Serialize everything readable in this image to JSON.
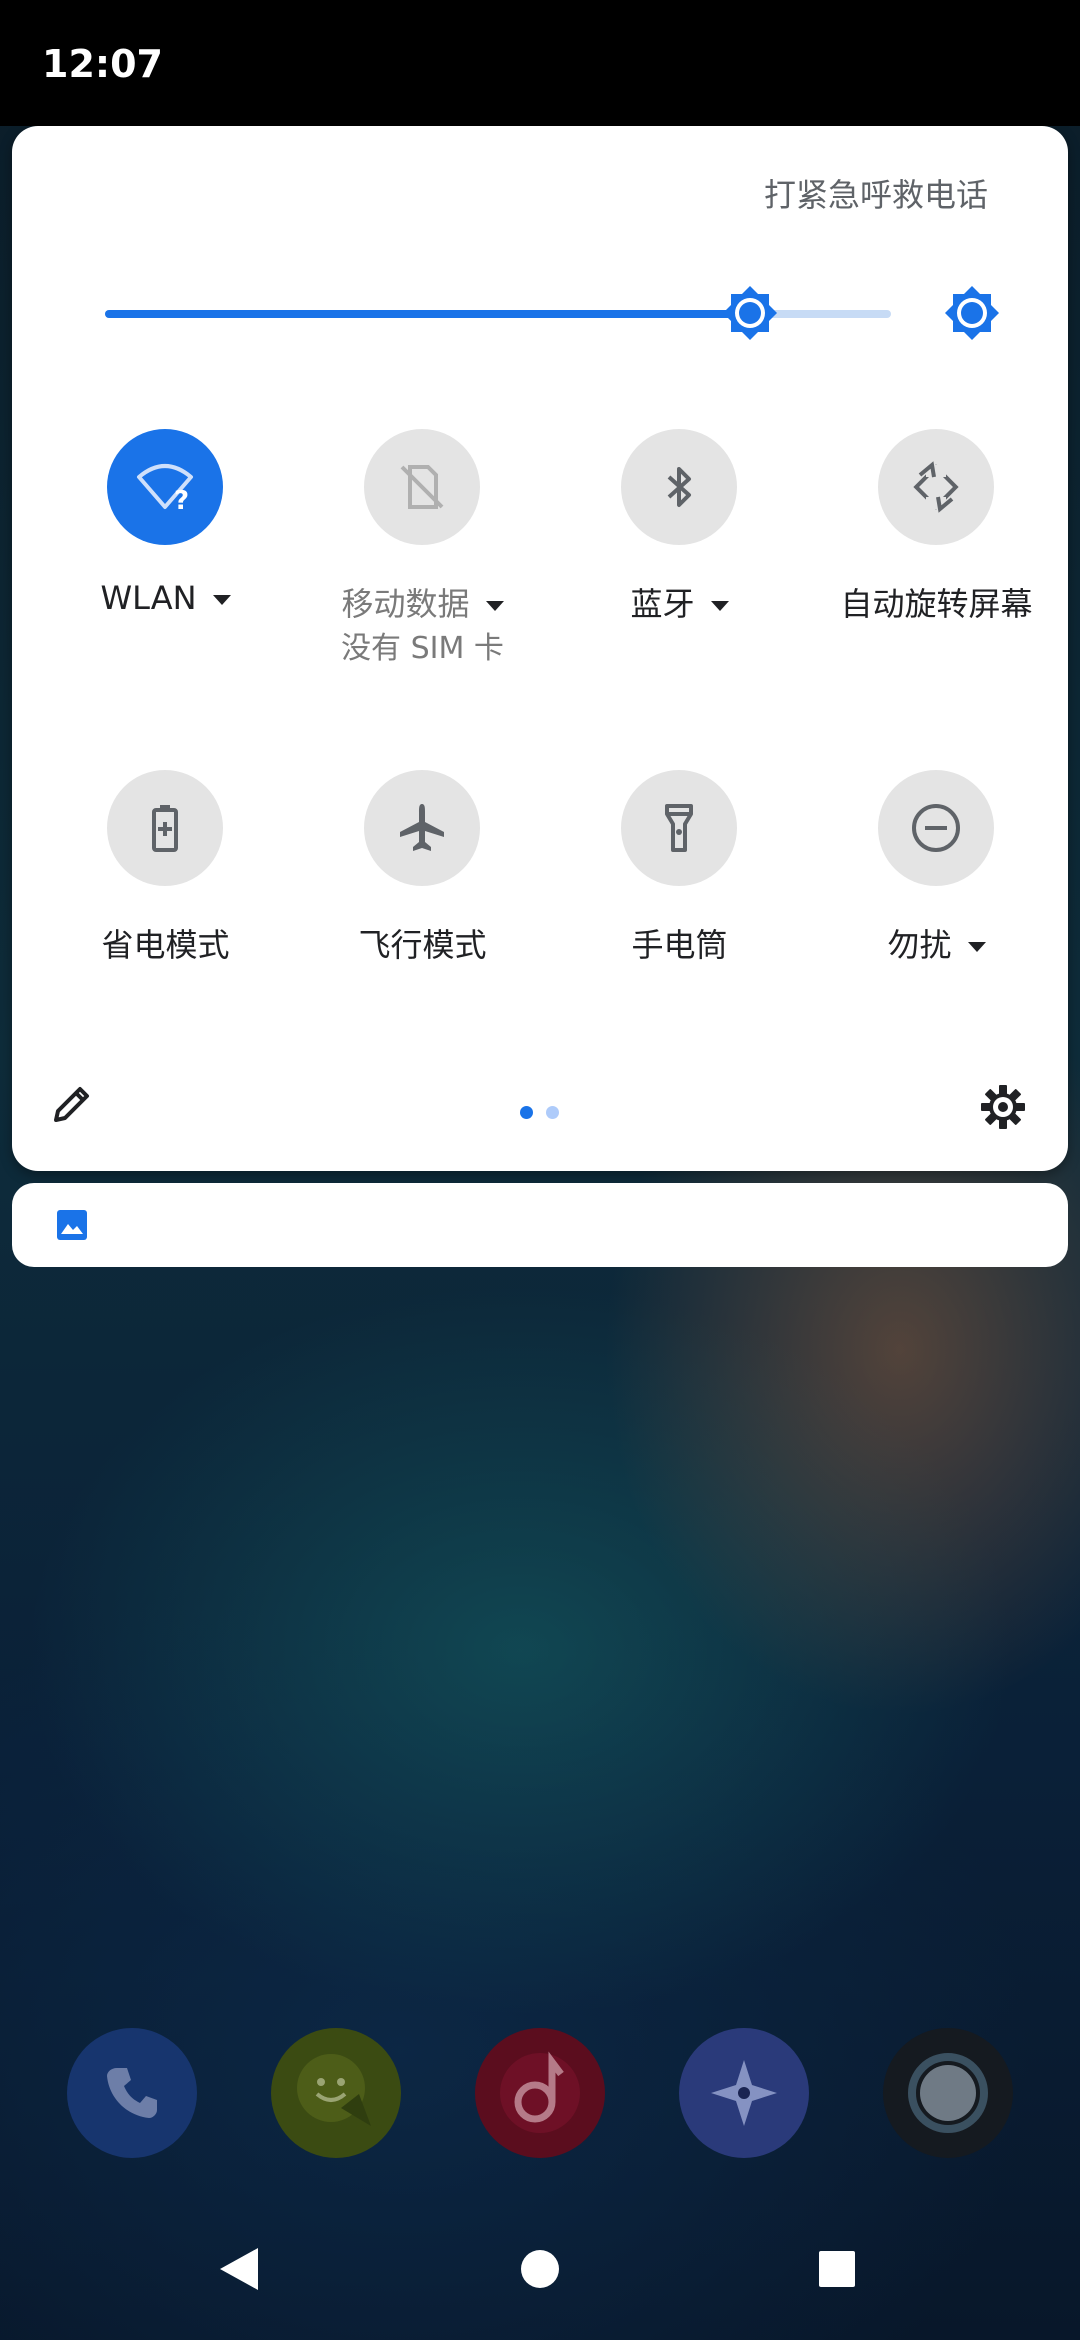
{
  "status_bar": {
    "time": "12:07"
  },
  "quick_settings": {
    "emergency_text": "打紧急呼救电话",
    "brightness": {
      "level": 0.83
    },
    "tiles": [
      {
        "id": "wlan",
        "label": "WLAN",
        "icon": "wifi-unknown-icon",
        "active": true,
        "has_dropdown": true
      },
      {
        "id": "mobile-data",
        "label": "移动数据",
        "sublabel": "没有 SIM 卡",
        "icon": "no-sim-icon",
        "active": false,
        "has_dropdown": true
      },
      {
        "id": "bluetooth",
        "label": "蓝牙",
        "icon": "bluetooth-icon",
        "active": false,
        "has_dropdown": true
      },
      {
        "id": "auto-rotate",
        "label": "自动旋转屏幕",
        "icon": "rotate-icon",
        "active": false,
        "has_dropdown": false
      },
      {
        "id": "battery-saver",
        "label": "省电模式",
        "icon": "battery-saver-icon",
        "active": false,
        "has_dropdown": false
      },
      {
        "id": "airplane",
        "label": "飞行模式",
        "icon": "airplane-icon",
        "active": false,
        "has_dropdown": false
      },
      {
        "id": "flashlight",
        "label": "手电筒",
        "icon": "flashlight-icon",
        "active": false,
        "has_dropdown": false
      },
      {
        "id": "dnd",
        "label": "勿扰",
        "icon": "do-not-disturb-icon",
        "active": false,
        "has_dropdown": true
      }
    ],
    "page_indicator": {
      "current": 1,
      "total": 2
    }
  },
  "notification": {
    "icon": "image-icon"
  },
  "dock": [
    "phone-icon",
    "messages-icon",
    "music-icon",
    "navigation-icon",
    "camera-icon"
  ],
  "navigation": [
    "back-icon",
    "home-icon",
    "recents-icon"
  ],
  "colors": {
    "accent": "#1a73e8",
    "tile_inactive": "#e4e4e4"
  }
}
